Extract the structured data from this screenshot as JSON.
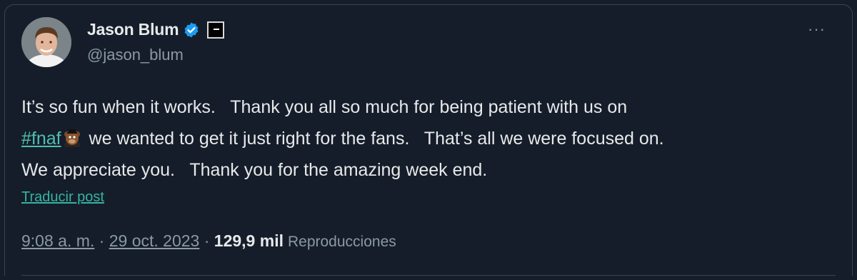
{
  "author": {
    "display_name": "Jason Blum",
    "handle": "@jason_blum",
    "avatar_icon": "profile-photo",
    "verified_icon": "verified-badge-icon",
    "affiliate_icon": "affiliate-badge-icon"
  },
  "more_menu": {
    "label": "···",
    "icon": "more-icon"
  },
  "post": {
    "line1": "It’s so fun when it works.   Thank you all so much for being patient with us on",
    "hashtag": "#fnaf",
    "line2_rest": " we wanted to get it just right for the fans.   That’s all we were focused on.",
    "line3": "We appreciate you.   Thank you for the amazing week end.",
    "emoji_icon": "freddy-fazbear-emoji"
  },
  "translate_label": "Traducir post",
  "meta": {
    "time": "9:08 a. m.",
    "separator": " · ",
    "date": "29 oct. 2023",
    "separator2": " · ",
    "views_count": "129,9 mil",
    "views_label": "Reproducciones"
  },
  "colors": {
    "background": "#151d2a",
    "link": "#36b3a0",
    "verified": "#1d9bf0"
  }
}
